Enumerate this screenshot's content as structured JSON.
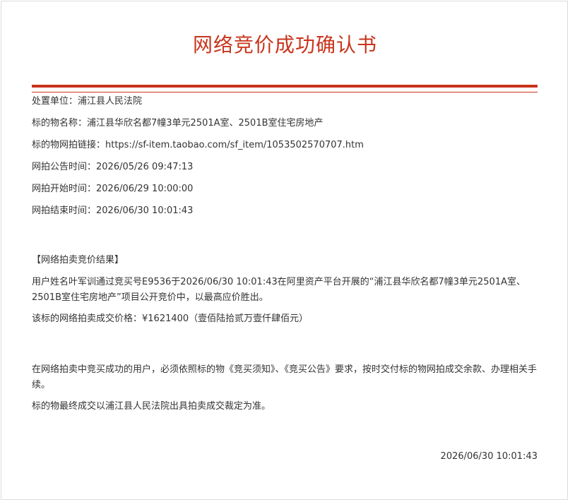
{
  "title": "网络竞价成功确认书",
  "info": {
    "disposal_unit": "处置单位：浦江县人民法院",
    "item_name": "标的物名称：浦江县华欣名都7幢3单元2501A室、2501B室住宅房地产",
    "item_link": "标的物网拍链接：https://sf-item.taobao.com/sf_item/1053502570707.htm",
    "announce_time": "网拍公告时间：2026/05/26 09:47:13",
    "start_time": "网拍开始时间：2026/06/29 10:00:00",
    "end_time": "网拍结束时间：2026/06/30 10:01:43"
  },
  "result": {
    "heading": "【网络拍卖竞价结果】",
    "paragraph": "用户姓名叶军训通过竞买号E9536于2026/06/30 10:01:43在阿里资产平台开展的“浦江县华欣名都7幢3单元2501A室、2501B室住宅房地产”项目公开竞价中，以最高应价胜出。",
    "price": "该标的网络拍卖成交价格：¥1621400（壹佰陆拾贰万壹仟肆佰元）"
  },
  "notice": {
    "paragraph1": "在网络拍卖中竞买成功的用户，必须依照标的物《竞买须知》、《竞买公告》要求，按时交付标的物网拍成交余款、办理相关手续。",
    "paragraph2": "标的物最终成交以浦江县人民法院出具拍卖成交裁定为准。"
  },
  "footer_date": "2026/06/30 10:01:43"
}
